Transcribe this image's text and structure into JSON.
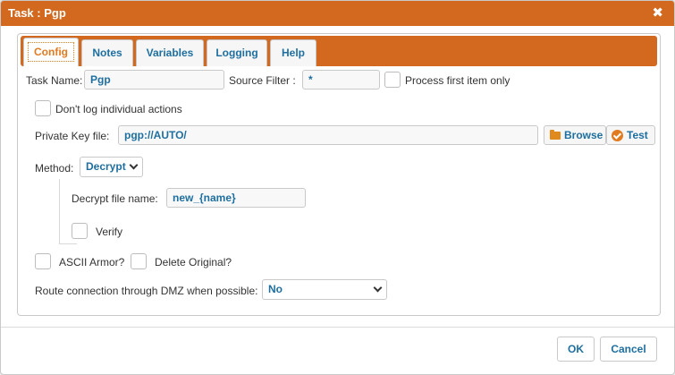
{
  "dialog": {
    "title": "Task : Pgp",
    "close_glyph": "✖"
  },
  "tabs": [
    {
      "label": "Config",
      "active": true
    },
    {
      "label": "Notes"
    },
    {
      "label": "Variables"
    },
    {
      "label": "Logging"
    },
    {
      "label": "Help"
    }
  ],
  "form": {
    "task_name_label": "Task Name:",
    "task_name_value": "Pgp",
    "source_filter_label": "Source Filter :",
    "source_filter_value": "*",
    "process_first_label": "Process first item only",
    "dont_log_label": "Don't log individual actions",
    "private_key_label": "Private Key file:",
    "private_key_value": "pgp://AUTO/",
    "browse_label": "Browse",
    "test_label": "Test",
    "method_label": "Method:",
    "method_value": "Decrypt",
    "decrypt_name_label": "Decrypt file name:",
    "decrypt_name_value": "new_{name}",
    "verify_label": "Verify",
    "ascii_armor_label": "ASCII Armor?",
    "delete_original_label": "Delete Original?",
    "dmz_label": "Route connection through DMZ when possible:",
    "dmz_value": "No"
  },
  "footer": {
    "ok_label": "OK",
    "cancel_label": "Cancel"
  },
  "colors": {
    "accent": "#d2691e",
    "link": "#1e6f9f",
    "active_tab_text": "#e07b1f"
  }
}
